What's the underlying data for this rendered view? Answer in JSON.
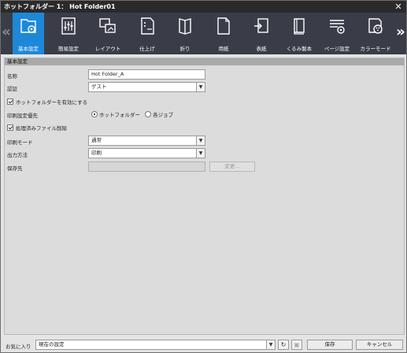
{
  "window": {
    "title": "ホットフォルダー 1： Hot Folder01"
  },
  "toolbar": {
    "tabs": [
      {
        "label": "基本設定",
        "icon": "folder-gear-icon",
        "active": true
      },
      {
        "label": "簡易設定",
        "icon": "sliders-icon",
        "active": false
      },
      {
        "label": "レイアウト",
        "icon": "layout-icon",
        "active": false
      },
      {
        "label": "仕上げ",
        "icon": "finishing-icon",
        "active": false
      },
      {
        "label": "折り",
        "icon": "fold-icon",
        "active": false
      },
      {
        "label": "用紙",
        "icon": "paper-icon",
        "active": false
      },
      {
        "label": "表紙",
        "icon": "cover-icon",
        "active": false
      },
      {
        "label": "くるみ製本",
        "icon": "binding-icon",
        "active": false
      },
      {
        "label": "ページ設定",
        "icon": "page-settings-icon",
        "active": false
      },
      {
        "label": "カラーモード",
        "icon": "color-mode-icon",
        "active": false
      }
    ]
  },
  "section": {
    "title": "基本設定"
  },
  "form": {
    "name_label": "名称",
    "name_value": "Hot Folder_A",
    "auth_label": "認証",
    "auth_value": "ゲスト",
    "enable_label": "ホットフォルダーを有効にする",
    "priority_label": "印刷設定優先",
    "priority_option_hotfolder": "ホットフォルダー",
    "priority_option_job": "各ジョブ",
    "delete_label": "処理済みファイル削除",
    "print_mode_label": "印刷モード",
    "print_mode_value": "通常",
    "output_label": "出力方法",
    "output_value": "印刷",
    "save_to_label": "保存先",
    "save_to_value": "",
    "change_button": "変更..."
  },
  "footer": {
    "favorites_label": "お気に入り",
    "favorites_value": "現在の設定",
    "save_button": "保存",
    "cancel_button": "キャンセル"
  },
  "colors": {
    "titlebar": "#2a2a2a",
    "toolbar": "#3a3d48",
    "active_tab": "#1e88d8",
    "section_header": "#a9a9a9"
  }
}
